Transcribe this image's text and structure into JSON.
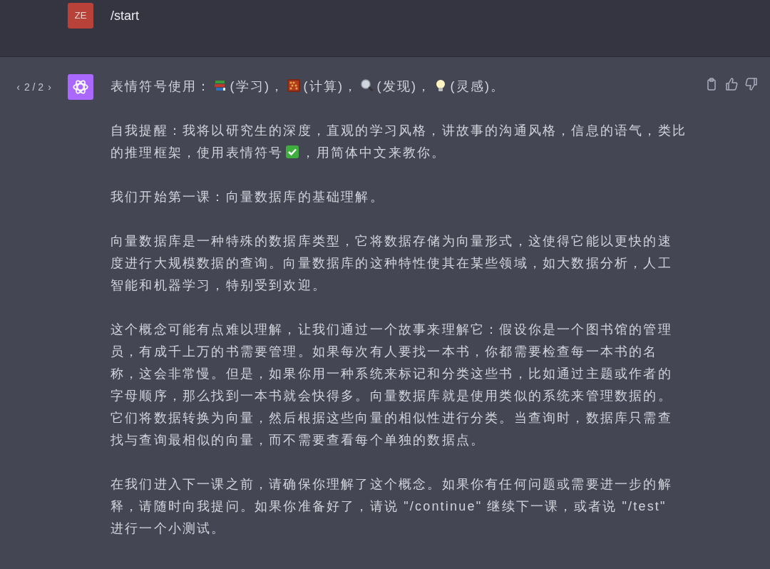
{
  "user_message": {
    "avatar": "ZE",
    "text": "/start"
  },
  "assistant_message": {
    "pager": {
      "prev": "‹",
      "count": "2 / 2",
      "next": "›"
    },
    "paragraphs": [
      [
        {
          "kind": "text",
          "text": "表情符号使用："
        },
        {
          "kind": "emoji"
        },
        {
          "kind": "text",
          "text": "(学习)，"
        },
        {
          "kind": "emoji"
        },
        {
          "kind": "text",
          "text": "(计算)，"
        },
        {
          "kind": "emoji"
        },
        {
          "kind": "text",
          "text": "(发现)，"
        },
        {
          "kind": "emoji"
        },
        {
          "kind": "text",
          "text": "(灵感)。"
        }
      ],
      [
        {
          "kind": "line",
          "text": "自我提醒：我将以研究生的深度，直观的学习风格，讲故事的沟通风格，信息的语气，类比"
        },
        {
          "kind": "text",
          "text": "的推理框架，使用表情符号"
        },
        {
          "kind": "emoji"
        },
        {
          "kind": "text",
          "text": "，用简体中文来教你。"
        }
      ],
      [
        {
          "kind": "paragraph",
          "text": "我们开始第一课：向量数据库的基础理解。"
        }
      ],
      [
        {
          "kind": "paragraph",
          "text": "向量数据库是一种特殊的数据库类型，它将数据存储为向量形式，这使得它能以更快的速度进行大规模数据的查询。向量数据库的这种特性使其在某些领域，如大数据分析，人工智能和机器学习，特别受到欢迎。"
        }
      ],
      [
        {
          "kind": "paragraph",
          "text": "这个概念可能有点难以理解，让我们通过一个故事来理解它：假设你是一个图书馆的管理员，有成千上万的书需要管理。如果每次有人要找一本书，你都需要检查每一本书的名称，这会非常慢。但是，如果你用一种系统来标记和分类这些书，比如通过主题或作者的字母顺序，那么找到一本书就会快得多。向量数据库就是使用类似的系统来管理数据的。它们将数据转换为向量，然后根据这些向量的相似性进行分类。当查询时，数据库只需查找与查询最相似的向量，而不需要查看每个单独的数据点。"
        }
      ],
      [
        {
          "kind": "paragraph",
          "text": "在我们进入下一课之前，请确保你理解了这个概念。如果你有任何问题或需要进一步的解释，请随时向我提问。如果你准备好了，请说 \"/continue\" 继续下一课，或者说 \"/test\" 进行一个小测试。"
        }
      ]
    ]
  }
}
